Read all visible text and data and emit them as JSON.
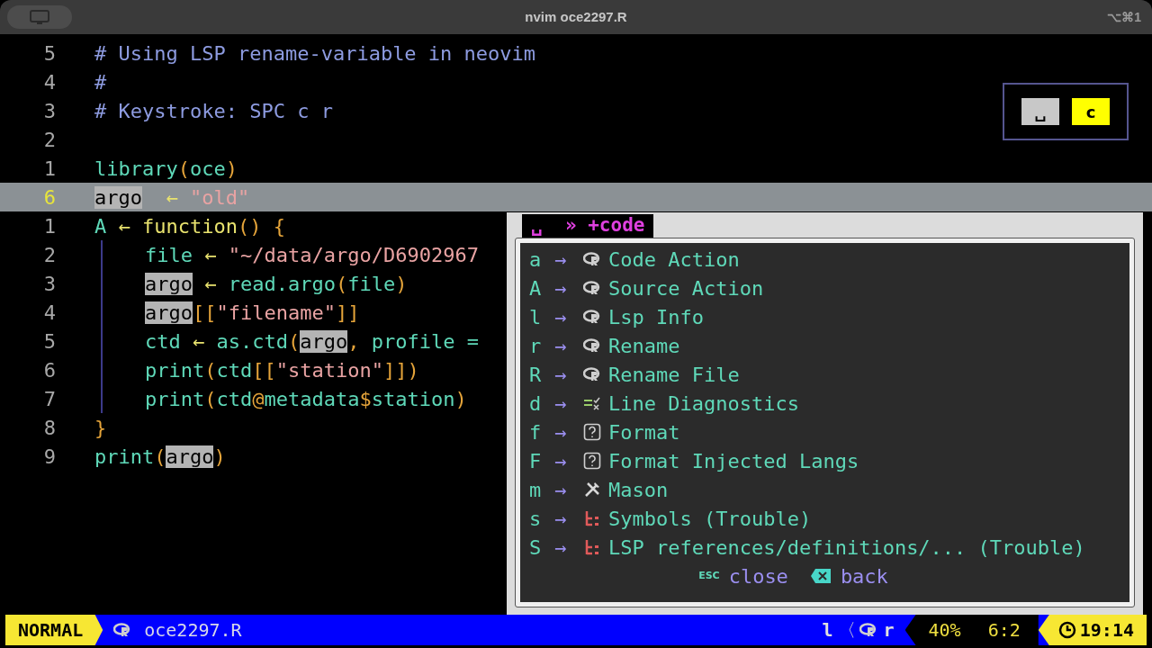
{
  "window": {
    "title": "nvim oce2297.R",
    "shortcut": "⌥⌘1"
  },
  "lines": [
    {
      "number": "5",
      "current": false,
      "indent": false,
      "tokens": [
        {
          "t": "# Using LSP rename-variable in neovim",
          "kind": "comment"
        }
      ]
    },
    {
      "number": "4",
      "current": false,
      "indent": false,
      "tokens": [
        {
          "t": "#",
          "kind": "comment"
        }
      ]
    },
    {
      "number": "3",
      "current": false,
      "indent": false,
      "tokens": [
        {
          "t": "# Keystroke: SPC c r",
          "kind": "comment"
        }
      ]
    },
    {
      "number": "2",
      "current": false,
      "indent": false
    },
    {
      "number": "1",
      "current": false,
      "indent": false,
      "tokens": [
        {
          "t": "library",
          "kind": "fn"
        },
        {
          "t": "(",
          "kind": "paren"
        },
        {
          "t": "oce",
          "kind": "fn"
        },
        {
          "t": ")",
          "kind": "paren"
        }
      ]
    },
    {
      "number": "6",
      "current": true,
      "indent": false,
      "tokens": [
        {
          "t": "argo",
          "kind": "hl"
        },
        {
          "t": "  ← ",
          "kind": "op"
        },
        {
          "t": "\"old\"",
          "kind": "str"
        }
      ]
    },
    {
      "number": "1",
      "current": false,
      "indent": false,
      "tokens": [
        {
          "t": "A",
          "kind": "fn"
        },
        {
          "t": " ← function",
          "kind": "op"
        },
        {
          "t": "() {",
          "kind": "paren"
        }
      ]
    },
    {
      "number": "2",
      "current": false,
      "indent": true,
      "tokens": [
        {
          "t": "file",
          "kind": "fn"
        },
        {
          "t": " ← ",
          "kind": "op"
        },
        {
          "t": "\"~/data/argo/D6902967",
          "kind": "str"
        }
      ]
    },
    {
      "number": "3",
      "current": false,
      "indent": true,
      "tokens": [
        {
          "t": "argo",
          "kind": "hl"
        },
        {
          "t": " ← ",
          "kind": "op"
        },
        {
          "t": "read.argo",
          "kind": "fn"
        },
        {
          "t": "(",
          "kind": "paren"
        },
        {
          "t": "file",
          "kind": "fn"
        },
        {
          "t": ")",
          "kind": "paren"
        }
      ]
    },
    {
      "number": "4",
      "current": false,
      "indent": true,
      "tokens": [
        {
          "t": "argo",
          "kind": "hl"
        },
        {
          "t": "[[",
          "kind": "paren"
        },
        {
          "t": "\"filename\"",
          "kind": "str"
        },
        {
          "t": "]]",
          "kind": "paren"
        }
      ]
    },
    {
      "number": "5",
      "current": false,
      "indent": true,
      "tokens": [
        {
          "t": "ctd",
          "kind": "fn"
        },
        {
          "t": " ← ",
          "kind": "op"
        },
        {
          "t": "as.ctd",
          "kind": "fn"
        },
        {
          "t": "(",
          "kind": "paren"
        },
        {
          "t": "argo",
          "kind": "hl"
        },
        {
          "t": ", ",
          "kind": "paren"
        },
        {
          "t": "profile =",
          "kind": "fn"
        }
      ]
    },
    {
      "number": "6",
      "current": false,
      "indent": true,
      "tokens": [
        {
          "t": "print",
          "kind": "fn"
        },
        {
          "t": "(",
          "kind": "paren"
        },
        {
          "t": "ctd",
          "kind": "fn"
        },
        {
          "t": "[[",
          "kind": "paren"
        },
        {
          "t": "\"station\"",
          "kind": "str"
        },
        {
          "t": "]])",
          "kind": "paren"
        }
      ]
    },
    {
      "number": "7",
      "current": false,
      "indent": true,
      "tokens": [
        {
          "t": "print",
          "kind": "fn"
        },
        {
          "t": "(",
          "kind": "paren"
        },
        {
          "t": "ctd",
          "kind": "fn"
        },
        {
          "t": "@",
          "kind": "paren"
        },
        {
          "t": "metadata",
          "kind": "fn"
        },
        {
          "t": "$",
          "kind": "paren"
        },
        {
          "t": "station",
          "kind": "fn"
        },
        {
          "t": ")",
          "kind": "paren"
        }
      ]
    },
    {
      "number": "8",
      "current": false,
      "indent": false,
      "tokens": [
        {
          "t": "}",
          "kind": "paren"
        }
      ]
    },
    {
      "number": "9",
      "current": false,
      "indent": false,
      "tokens": [
        {
          "t": "print",
          "kind": "fn"
        },
        {
          "t": "(",
          "kind": "paren"
        },
        {
          "t": "argo",
          "kind": "hl"
        },
        {
          "t": ")",
          "kind": "paren"
        }
      ]
    }
  ],
  "keys": [
    {
      "label": "␣",
      "color": "#c8c8c8"
    },
    {
      "label": "c",
      "color": "#ffff00"
    }
  ],
  "popup": {
    "title": "␣  » +code",
    "items": [
      {
        "key": "a",
        "arrow": "→",
        "kind": "r",
        "label": "Code Action"
      },
      {
        "key": "A",
        "arrow": "→",
        "kind": "r",
        "label": "Source Action"
      },
      {
        "key": "l",
        "arrow": "→",
        "kind": "r",
        "label": "Lsp Info"
      },
      {
        "key": "r",
        "arrow": "→",
        "kind": "r",
        "label": "Rename"
      },
      {
        "key": "R",
        "arrow": "→",
        "kind": "r",
        "label": "Rename File"
      },
      {
        "key": "d",
        "arrow": "→",
        "kind": "diagnostics",
        "label": "Line Diagnostics"
      },
      {
        "key": "f",
        "arrow": "→",
        "kind": "question",
        "label": "Format"
      },
      {
        "key": "F",
        "arrow": "→",
        "kind": "question",
        "label": "Format Injected Langs"
      },
      {
        "key": "m",
        "arrow": "→",
        "kind": "tools",
        "label": "Mason"
      },
      {
        "key": "s",
        "arrow": "→",
        "kind": "tree",
        "label": "Symbols (Trouble)"
      },
      {
        "key": "S",
        "arrow": "→",
        "kind": "tree",
        "label": "LSP references/definitions/... (Trouble)"
      }
    ],
    "footer": {
      "esc": "ESC",
      "close": "close",
      "back": "back"
    }
  },
  "status_bar": {
    "mode": "NORMAL",
    "file": "oce2297.R",
    "key": "l",
    "separator": "〈",
    "lsp": "r",
    "percent": "40%",
    "position": "6:2",
    "time": "19:14"
  }
}
